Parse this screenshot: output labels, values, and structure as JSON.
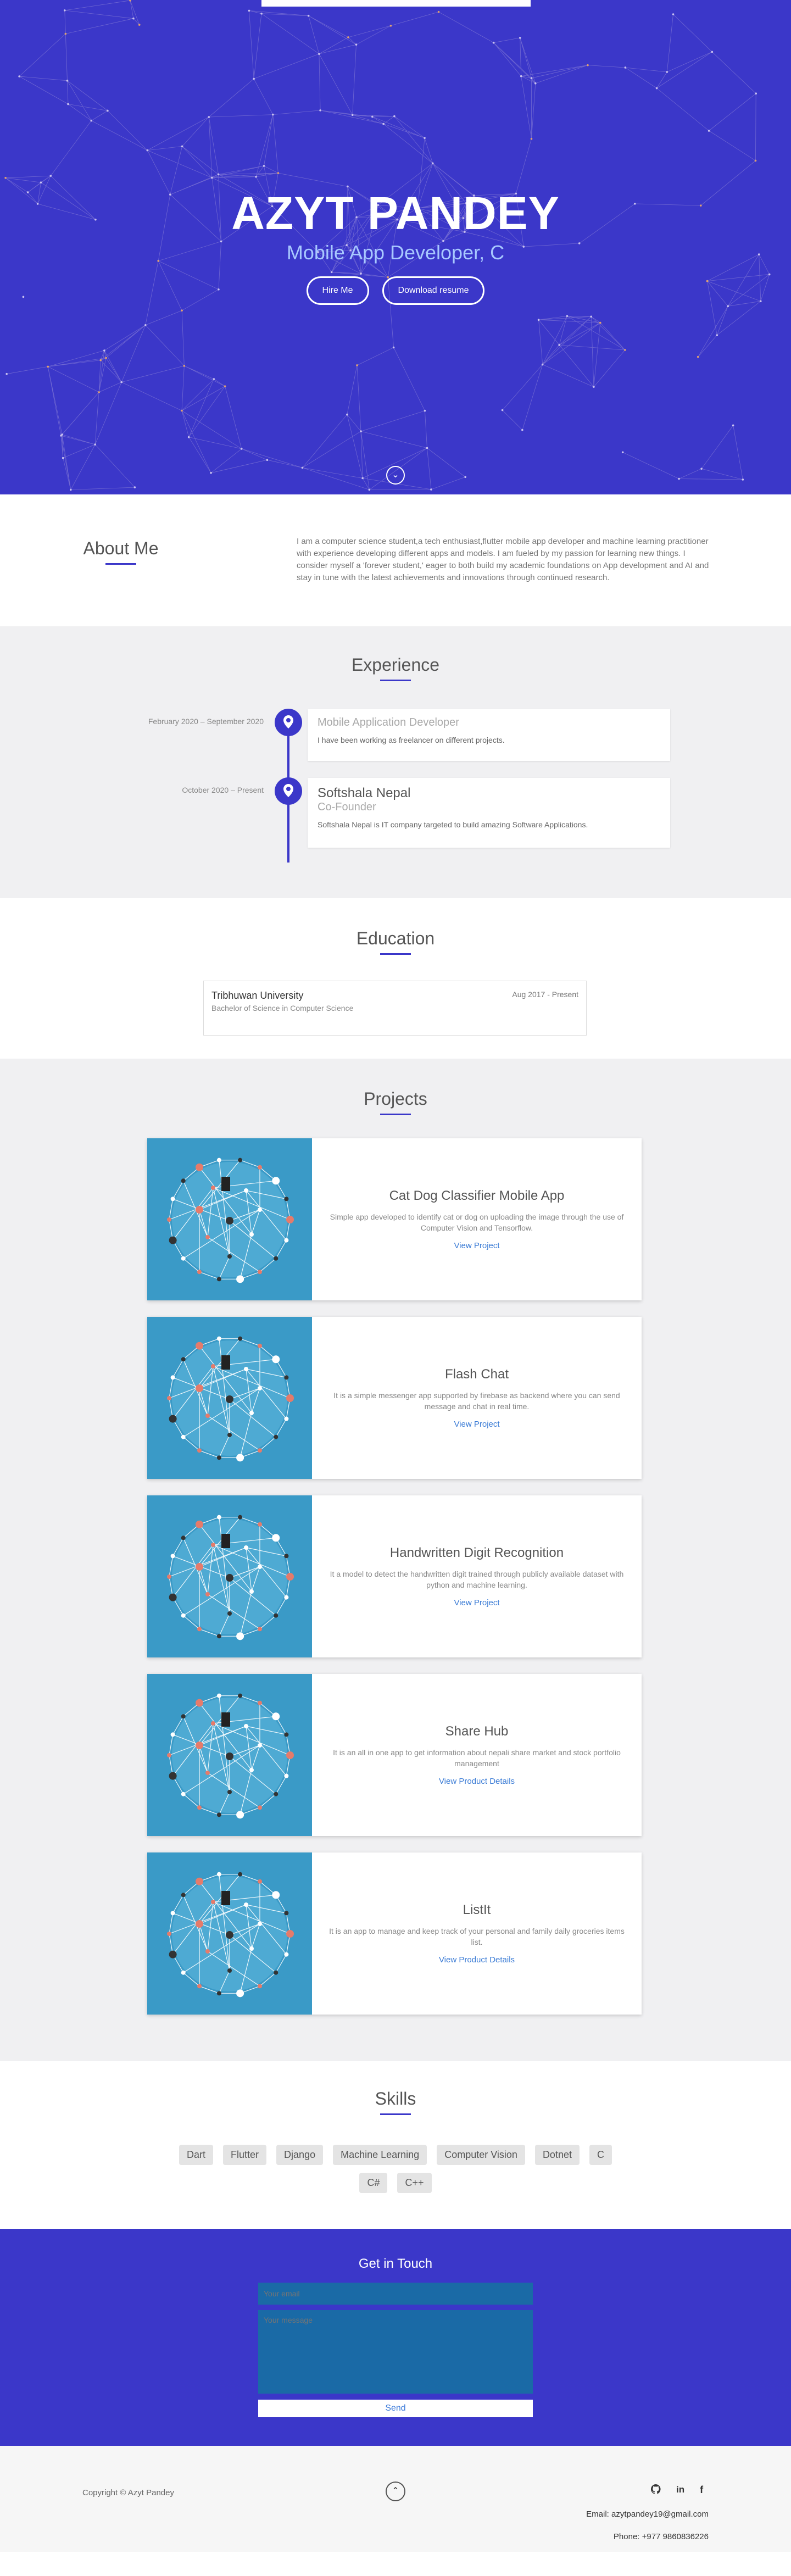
{
  "hero": {
    "name": "AZYT PANDEY",
    "subtitle": "Mobile App Developer, C",
    "hire_label": "Hire Me",
    "resume_label": "Download resume"
  },
  "about": {
    "title": "About Me",
    "text": "I am a computer science student,a tech enthusiast,flutter mobile app developer and machine learning practitioner with experience developing different apps and models. I am fueled by my passion for learning new things. I consider myself a 'forever student,' eager to both build my academic foundations on App development and AI and stay in tune with the latest achievements and innovations through continued research."
  },
  "experience": {
    "title": "Experience",
    "items": [
      {
        "date": "February 2020 – September 2020",
        "role": "Mobile Application Developer",
        "company": "",
        "desc": "I have been working as freelancer on different projects."
      },
      {
        "date": "October 2020 – Present",
        "company": "Softshala Nepal",
        "role": "Co-Founder",
        "desc": "Softshala Nepal is IT company targeted to build amazing Software Applications."
      }
    ]
  },
  "education": {
    "title": "Education",
    "school": "Tribhuwan University",
    "degree": "Bachelor of Science in Computer Science",
    "date": "Aug 2017 - Present"
  },
  "projects": {
    "title": "Projects",
    "items": [
      {
        "title": "Cat Dog Classifier Mobile App",
        "desc": "Simple app developed to identify cat or dog on uploading the image through the use of Computer Vision and Tensorflow.",
        "link": "View Project"
      },
      {
        "title": "Flash Chat",
        "desc": "It is a simple messenger app supported by firebase as backend where you can send message and chat in real time.",
        "link": "View Project"
      },
      {
        "title": "Handwritten Digit Recognition",
        "desc": "It a model to detect the handwritten digit trained through publicly available dataset with python and machine learning.",
        "link": "View Project"
      },
      {
        "title": "Share Hub",
        "desc": "It is an all in one app to get information about nepali share market and stock portfolio management",
        "link": "View Product Details"
      },
      {
        "title": "ListIt",
        "desc": "It is an app to manage and keep track of your personal and family daily groceries items list.",
        "link": "View Product Details"
      }
    ]
  },
  "skills": {
    "title": "Skills",
    "items": [
      "Dart",
      "Flutter",
      "Django",
      "Machine Learning",
      "Computer Vision",
      "Dotnet",
      "C",
      "C#",
      "C++"
    ]
  },
  "contact": {
    "title": "Get in Touch",
    "email_placeholder": "Your email",
    "message_placeholder": "Your message",
    "send_label": "Send"
  },
  "footer": {
    "copyright": "Copyright © Azyt Pandey",
    "email": "Email: azytpandey19@gmail.com",
    "phone": "Phone: +977 9860836226"
  },
  "colors": {
    "primary": "#3b37c9",
    "link": "#3a7bd5",
    "input": "#1a6aa6"
  }
}
